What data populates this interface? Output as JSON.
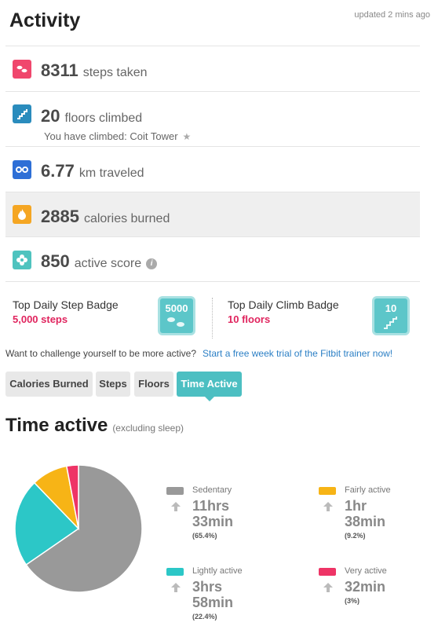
{
  "header": {
    "title": "Activity",
    "updated": "updated 2 mins ago"
  },
  "metrics": [
    {
      "icon": "footsteps-icon",
      "color": "#f0476d",
      "value": "8311",
      "label": "steps taken"
    },
    {
      "icon": "stairs-icon",
      "color": "#2a8cbd",
      "value": "20",
      "label": "floors climbed",
      "sub": "You have climbed: Coit Tower"
    },
    {
      "icon": "distance-icon",
      "color": "#2e6fd6",
      "value": "6.77",
      "label": "km traveled"
    },
    {
      "icon": "flame-icon",
      "color": "#f5a623",
      "value": "2885",
      "label": "calories burned"
    },
    {
      "icon": "flower-icon",
      "color": "#4fc3bf",
      "value": "850",
      "label": "active score"
    }
  ],
  "badges": {
    "step": {
      "title": "Top Daily Step Badge",
      "value": "5,000 steps",
      "badge_text": "5000"
    },
    "climb": {
      "title": "Top Daily Climb Badge",
      "value": "10 floors",
      "badge_text": "10"
    }
  },
  "challenge": {
    "text": "Want to challenge yourself to be more active?",
    "link": "Start a free week trial of the Fitbit trainer now!"
  },
  "tabs": [
    "Calories Burned",
    "Steps",
    "Floors",
    "Time Active"
  ],
  "active_tab": "Time Active",
  "time_active": {
    "title": "Time active",
    "note": "(excluding sleep)"
  },
  "chart_data": {
    "type": "pie",
    "categories": [
      "Sedentary",
      "Lightly active",
      "Fairly active",
      "Very active"
    ],
    "values": [
      65.4,
      22.4,
      9.2,
      3
    ],
    "colors": [
      "#999999",
      "#2cc7c7",
      "#f7b416",
      "#ee3466"
    ],
    "durations": [
      [
        "11hrs",
        "33min"
      ],
      [
        "3hrs",
        "58min"
      ],
      [
        "1hr",
        "38min"
      ],
      [
        "32min"
      ]
    ],
    "labels": [
      "(65.4%)",
      "(22.4%)",
      "(9.2%)",
      "(3%)"
    ]
  }
}
